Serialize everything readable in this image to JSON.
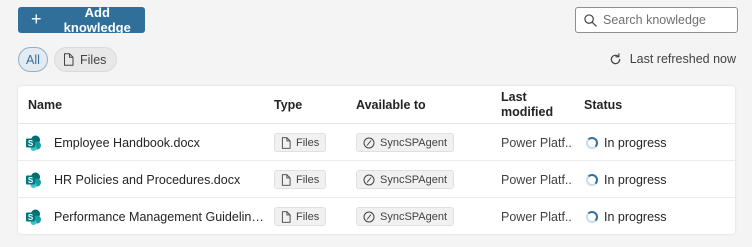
{
  "toolbar": {
    "add_button_label": "Add knowledge",
    "search_placeholder": "Search knowledge"
  },
  "filters": {
    "all_label": "All",
    "files_label": "Files"
  },
  "refresh": {
    "label": "Last refreshed now"
  },
  "table": {
    "headers": {
      "name": "Name",
      "type": "Type",
      "available_to": "Available to",
      "last_modified_line1": "Last",
      "last_modified_line2": "modified",
      "status": "Status"
    },
    "rows": [
      {
        "name": "Employee Handbook.docx",
        "type": "Files",
        "available_to": "SyncSPAgent",
        "last_modified": "Power Platf...",
        "status": "In progress"
      },
      {
        "name": "HR Policies and Procedures.docx",
        "type": "Files",
        "available_to": "SyncSPAgent",
        "last_modified": "Power Platf...",
        "status": "In progress"
      },
      {
        "name": "Performance Management Guidelines....",
        "type": "Files",
        "available_to": "SyncSPAgent",
        "last_modified": "Power Platf...",
        "status": "In progress"
      }
    ]
  },
  "colors": {
    "accent": "#2f6f99",
    "background": "#f4f4f4",
    "sharepoint_teal": "#038387"
  },
  "icons": {
    "add": "plus-icon",
    "search": "search-icon",
    "file": "file-icon",
    "refresh": "refresh-icon",
    "sharepoint": "sharepoint-icon",
    "agent": "agent-icon",
    "status": "spinner-icon"
  }
}
